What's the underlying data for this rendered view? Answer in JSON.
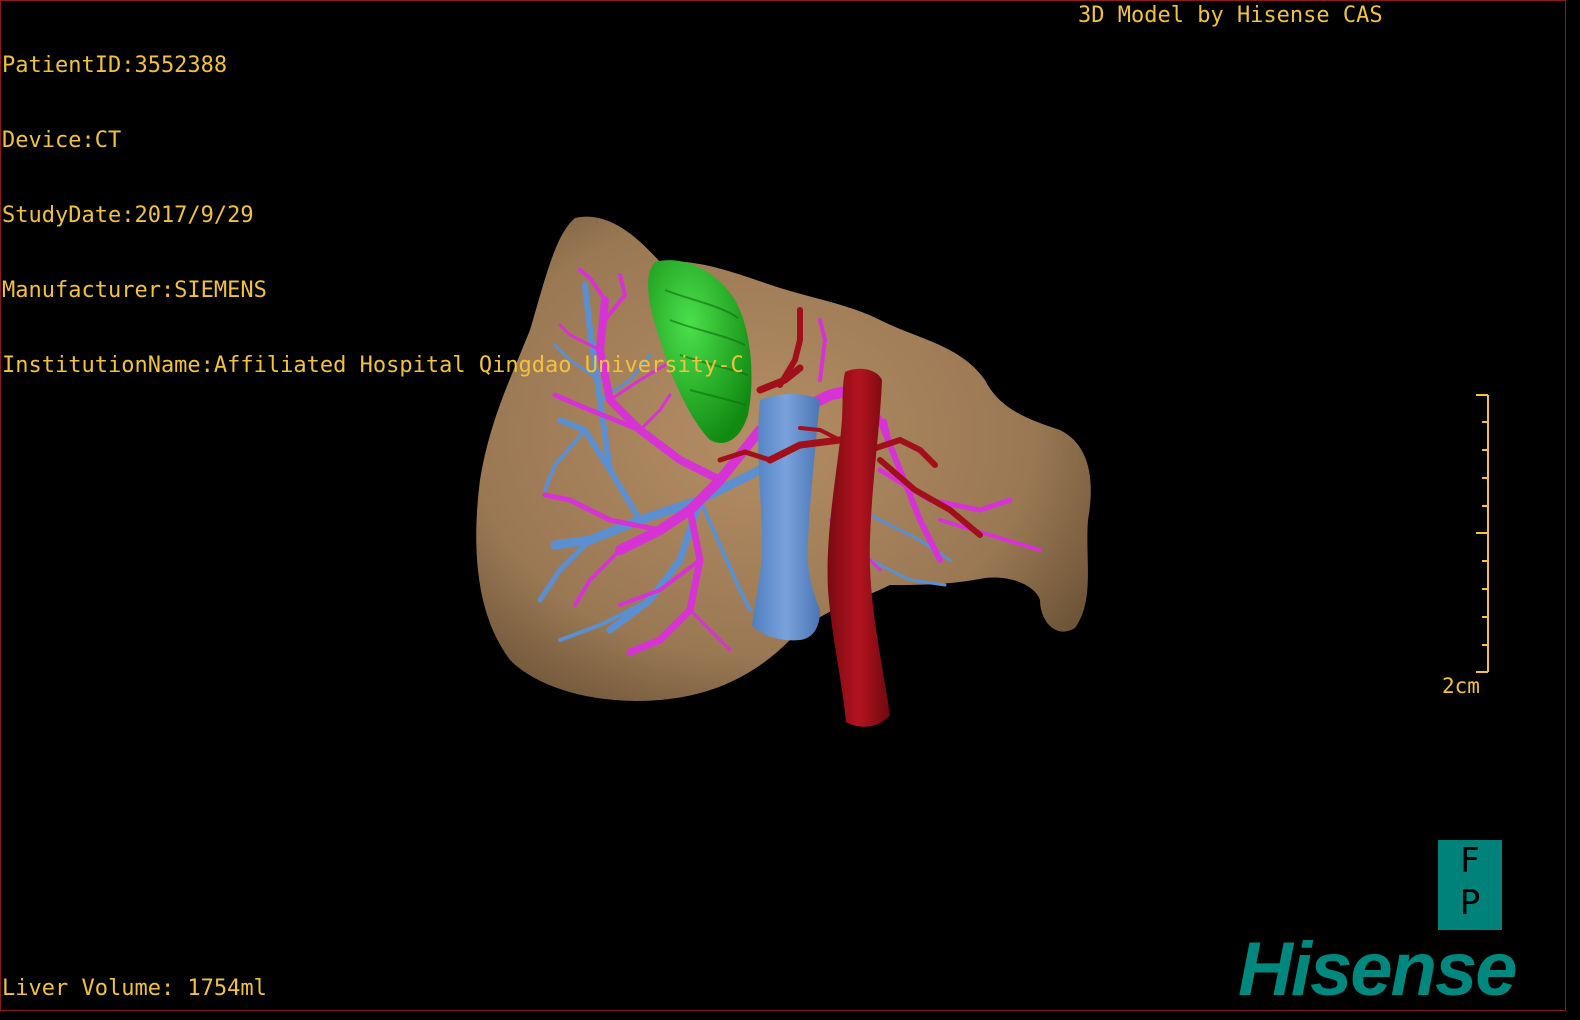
{
  "overlay": {
    "patient_id": "PatientID:3552388",
    "device": "Device:CT",
    "study_date": "StudyDate:2017/9/29",
    "manufacturer": "Manufacturer:SIEMENS",
    "institution": "InstitutionName:Affiliated Hospital Qingdao University-C",
    "model_credit": "3D Model by Hisense CAS",
    "liver_volume": "Liver Volume: 1754ml",
    "scale_label": "2cm"
  },
  "orientation": {
    "top": "F",
    "bottom": "P"
  },
  "brand": {
    "logo_text": "Hisense"
  },
  "colors": {
    "background": "#000000",
    "overlay_text": "#f2c23c",
    "liver": "#a07e58",
    "gallbladder": "#1fb21f",
    "hepatic_vein": "#d632d6",
    "portal_vein": "#5b8fd0",
    "vena_cava": "#6c94d0",
    "artery": "#a1101a",
    "brand": "#00877e"
  }
}
